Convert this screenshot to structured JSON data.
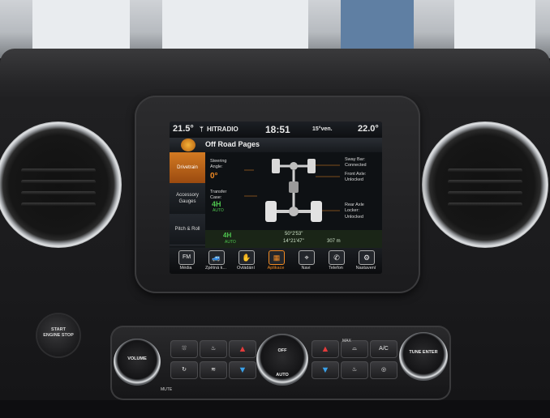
{
  "screen": {
    "status": {
      "outside_temp": "21.5°",
      "radio_icon": "antenna-icon",
      "station": "HITRADIO",
      "time": "18:51",
      "set_temp": "15°ven.",
      "cabin_temp": "22.0°"
    },
    "page_title": "Off Road Pages",
    "side_tabs": [
      {
        "label": "Drivetrain"
      },
      {
        "label": "Accessory Gauges"
      },
      {
        "label": "Pitch & Roll"
      }
    ],
    "drivetrain": {
      "steering_label": "Steering Angle:",
      "steering_value": "0°",
      "transfer_label": "Transfer Case:",
      "transfer_value": "4H",
      "transfer_sub": "AUTO",
      "sway_label": "Sway Bar:",
      "sway_value": "Connected",
      "front_axle_label": "Front Axle:",
      "front_axle_value": "Unlocked",
      "rear_axle_label": "Rear Axle Locker:",
      "rear_axle_value": "Unlocked"
    },
    "bottom_info": {
      "mode": "4H",
      "mode_sub": "AUTO",
      "latitude": "50°2'53\"",
      "longitude": "14°21'47\"",
      "elevation": "307 m"
    },
    "nav": [
      {
        "label": "Média",
        "icon": "radio-icon",
        "glyph": "FM"
      },
      {
        "label": "Zpětná k...",
        "icon": "car-icon",
        "glyph": "🚙"
      },
      {
        "label": "Ovládání",
        "icon": "hand-icon",
        "glyph": "✋"
      },
      {
        "label": "Aplikace",
        "icon": "apps-icon",
        "glyph": "▦"
      },
      {
        "label": "Navi",
        "icon": "navigation-icon",
        "glyph": "⌖"
      },
      {
        "label": "Telefon",
        "icon": "phone-icon",
        "glyph": "✆"
      },
      {
        "label": "Nastavení",
        "icon": "gear-icon",
        "glyph": "⚙"
      }
    ]
  },
  "controls": {
    "start_button": "START ENGINE STOP",
    "left_knob": "VOLUME",
    "right_knob": "TUNE ENTER",
    "center_knob_top": "OFF",
    "center_knob_bottom": "AUTO",
    "ac_label": "A/C",
    "max_label": "MAX",
    "mute_label": "MUTE"
  },
  "colors": {
    "accent": "#f08a24",
    "green": "#4fc64f",
    "heat": "#e33b3b",
    "cool": "#3aa0e8"
  }
}
